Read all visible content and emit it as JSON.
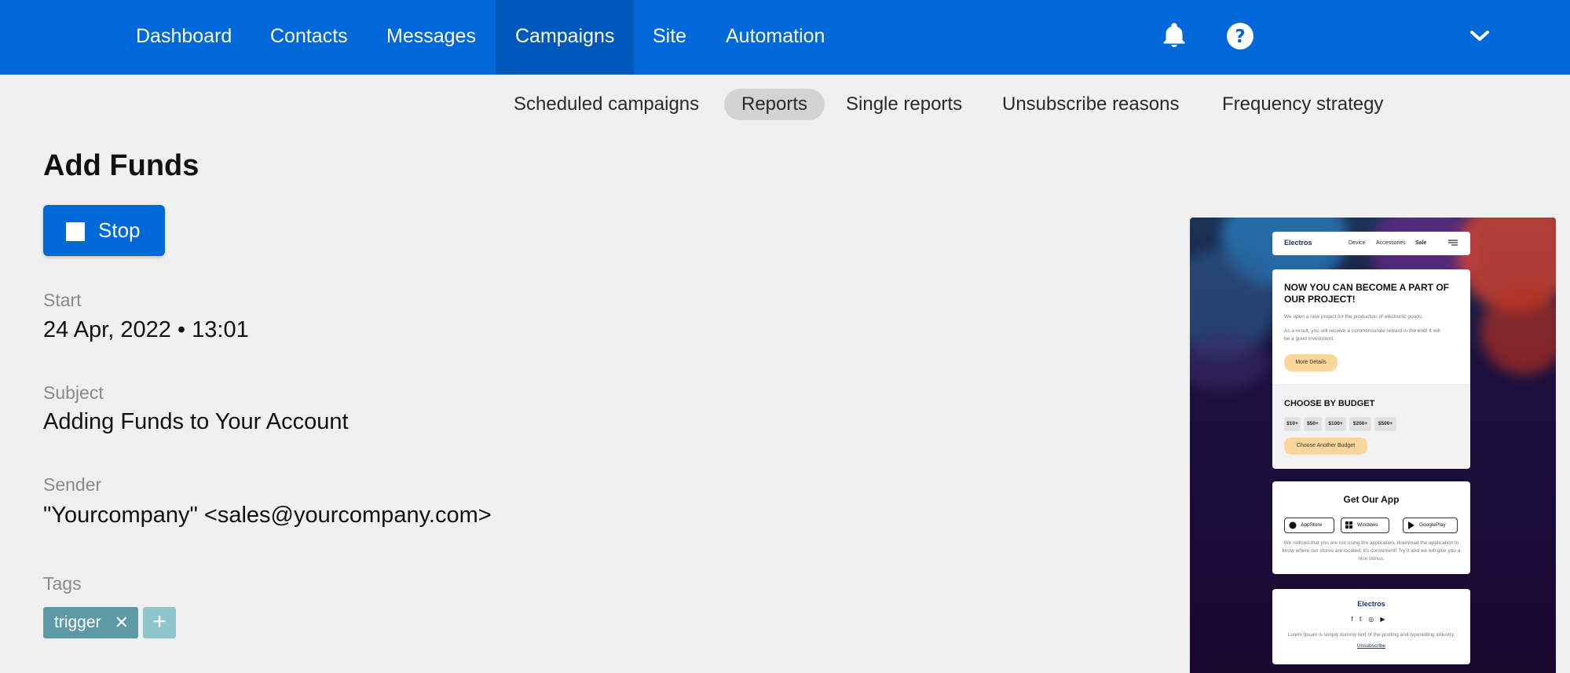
{
  "nav": {
    "items": [
      {
        "label": "Dashboard"
      },
      {
        "label": "Contacts"
      },
      {
        "label": "Messages"
      },
      {
        "label": "Campaigns",
        "active": true
      },
      {
        "label": "Site"
      },
      {
        "label": "Automation"
      }
    ],
    "icons": [
      "bell-icon",
      "help-icon",
      "chevron-down-icon"
    ]
  },
  "subnav": {
    "items": [
      {
        "label": "Scheduled campaigns"
      },
      {
        "label": "Reports",
        "active": true
      },
      {
        "label": "Single reports"
      },
      {
        "label": "Unsubscribe reasons"
      },
      {
        "label": "Frequency strategy"
      }
    ]
  },
  "page": {
    "title": "Add Funds",
    "stop_label": "Stop",
    "fields": {
      "start_label": "Start",
      "start_value": "24 Apr, 2022 • 13:01",
      "subject_label": "Subject",
      "subject_value": "Adding Funds to Your Account",
      "sender_label": "Sender",
      "sender_value": "\"Yourcompany\" <sales@yourcompany.com>",
      "tags_label": "Tags"
    },
    "tags": [
      {
        "label": "trigger"
      }
    ]
  },
  "preview": {
    "brand": "Electros",
    "menu": [
      "Device",
      "Accessories",
      "Sale"
    ],
    "hero_title": "NOW YOU CAN BECOME A PART OF OUR PROJECT!",
    "hero_text1": "We open a new project for the production of electronic goods.",
    "hero_text2": "As a result, you will receive a commensurate reward in the end! It will be a good investment.",
    "hero_button": "More Details",
    "budget_title": "CHOOSE BY BUDGET",
    "budgets": [
      "$10+",
      "$50+",
      "$100+",
      "$200+",
      "$500+"
    ],
    "budget_button": "Choose Another Budget",
    "app_title": "Get Our App",
    "stores": [
      "AppStore",
      "Windows",
      "GooglePlay"
    ],
    "app_text": "We noticed that you are not using the application, download the application to know where our stores are located, it's convenient! Try it and we will give you a nice bonus.",
    "footer_brand": "Electros",
    "footer_text": "Lorem Ipsum is simply dummy text of the printing and typesetting industry.",
    "unsubscribe": "Unsubscribe"
  }
}
